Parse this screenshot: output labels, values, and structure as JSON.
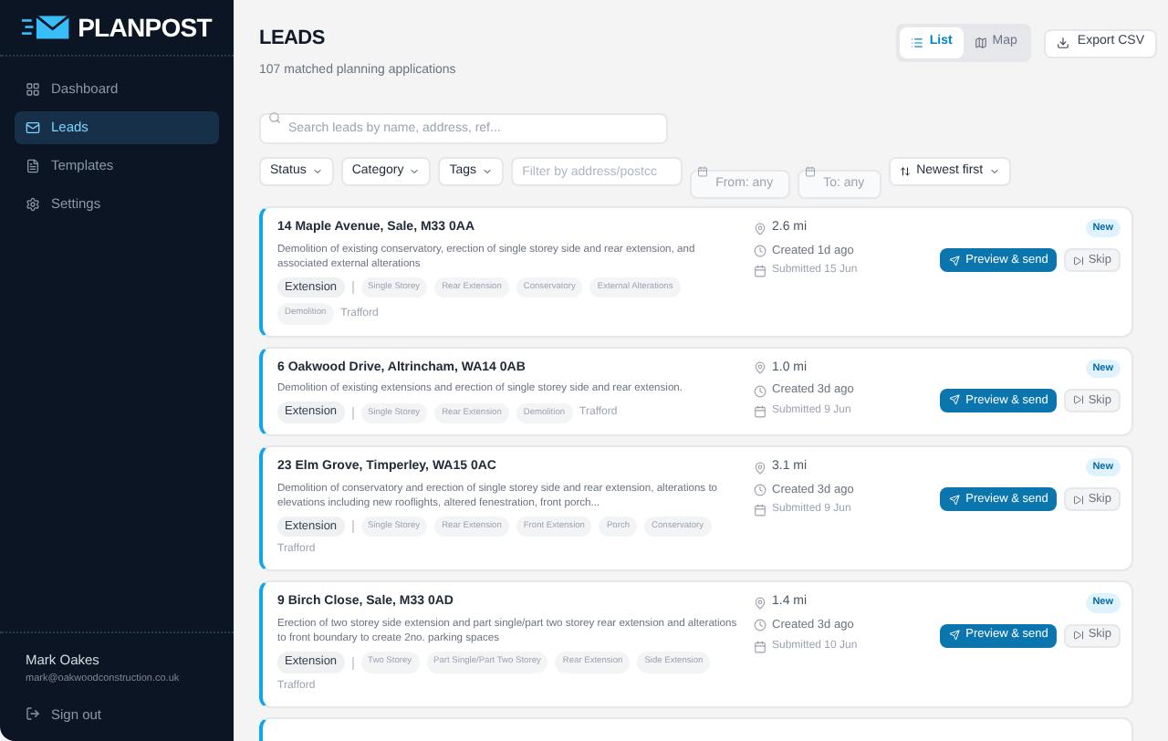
{
  "sidebar": {
    "logo": "PLANPOST",
    "items": [
      {
        "label": "Dashboard",
        "selected": false
      },
      {
        "label": "Leads",
        "selected": true
      },
      {
        "label": "Templates",
        "selected": false
      },
      {
        "label": "Settings",
        "selected": false
      }
    ],
    "user": {
      "name": "Mark Oakes",
      "email": "mark@oakwoodconstruction.co.uk"
    },
    "sign_out": "Sign out"
  },
  "header": {
    "title": "LEADS",
    "subtitle": "107 matched planning applications",
    "views": [
      {
        "label": "List",
        "selected": true
      },
      {
        "label": "Map",
        "selected": false
      }
    ],
    "export": "Export CSV"
  },
  "search": {
    "placeholder": "Search leads by name, address, ref..."
  },
  "filters": {
    "dropdowns": [
      "Status",
      "Category",
      "Tags"
    ],
    "address": {
      "placeholder": "Filter by address/postcc"
    },
    "from": {
      "placeholder": "From: any"
    },
    "to": {
      "placeholder": "To: any"
    },
    "sort": "Newest first"
  },
  "leads": [
    {
      "address": "14 Maple Avenue, Sale, M33 0AA",
      "description": "Demolition of existing conservatory, erection of single storey side and rear extension, and associated external alterations",
      "category": "Extension",
      "tags": [
        "Single Storey",
        "Rear Extension",
        "Conservatory",
        "External Alterations",
        "Demolition"
      ],
      "council": "Trafford",
      "distance": "2.6 mi",
      "created": "Created 1d ago",
      "submitted": "Submitted 15 Jun",
      "badge": "New",
      "send": "Preview & send",
      "skip": "Skip"
    },
    {
      "address": "6 Oakwood Drive, Altrincham, WA14 0AB",
      "description": "Demolition of existing extensions and erection of single storey side and rear extension.",
      "category": "Extension",
      "tags": [
        "Single Storey",
        "Rear Extension",
        "Demolition"
      ],
      "council": "Trafford",
      "distance": "1.0 mi",
      "created": "Created 3d ago",
      "submitted": "Submitted 9 Jun",
      "badge": "New",
      "send": "Preview & send",
      "skip": "Skip"
    },
    {
      "address": "23 Elm Grove, Timperley, WA15 0AC",
      "description": "Demolition of conservatory and erection of single storey side and rear extension, alterations to elevations including new rooflights, altered fenestration, front porch...",
      "category": "Extension",
      "tags": [
        "Single Storey",
        "Rear Extension",
        "Front Extension",
        "Porch",
        "Conservatory"
      ],
      "council": "Trafford",
      "distance": "3.1 mi",
      "created": "Created 3d ago",
      "submitted": "Submitted 9 Jun",
      "badge": "New",
      "send": "Preview & send",
      "skip": "Skip"
    },
    {
      "address": "9 Birch Close, Sale, M33 0AD",
      "description": "Erection of two storey side extension and part single/part two storey rear extension and alterations to front boundary to create 2no. parking spaces",
      "category": "Extension",
      "tags": [
        "Two Storey",
        "Part Single/Part Two Storey",
        "Rear Extension",
        "Side Extension"
      ],
      "council": "Trafford",
      "distance": "1.4 mi",
      "created": "Created 3d ago",
      "submitted": "Submitted 10 Jun",
      "badge": "New",
      "send": "Preview & send",
      "skip": "Skip"
    }
  ]
}
